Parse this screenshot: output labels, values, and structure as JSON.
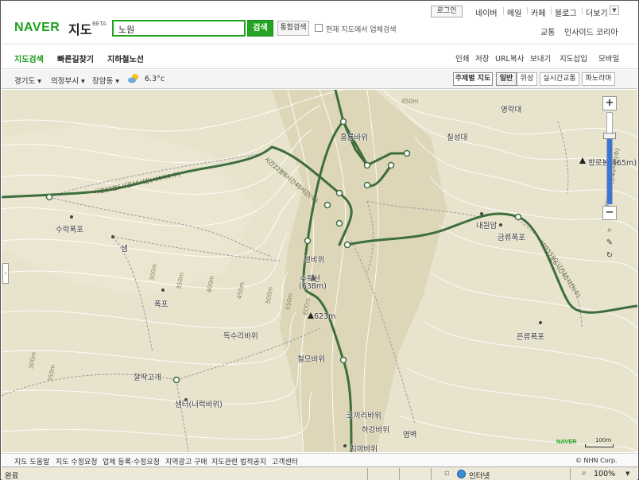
{
  "header": {
    "logo": "NAVER",
    "service": "지도",
    "beta": "BETA",
    "search_value": "노원",
    "search_button": "검색",
    "total_search_button": "통합검색",
    "inmap_label": "현재 지도에서 업체검색",
    "login": "로그인",
    "top_links": [
      "네이버",
      "메일",
      "카페",
      "블로그",
      "더보기"
    ],
    "more_icon": "chevron-down-icon",
    "right_links": [
      "교통",
      "인사이드 코리아"
    ]
  },
  "nav": {
    "tabs": [
      "지도검색",
      "빠른길찾기",
      "지하철노선"
    ],
    "tools": [
      "인쇄",
      "저장",
      "URL복사",
      "보내기",
      "지도삽입",
      "모바일"
    ],
    "active_color": "#1a9a1a"
  },
  "toolbar": {
    "locations": [
      "경기도",
      "의정부시",
      "장암동"
    ],
    "weather_icon": "sun-cloud-icon",
    "temperature": "6.3°c",
    "buttons": [
      "주제별 지도",
      "일반",
      "위성",
      "실시간교통",
      "파노라마"
    ]
  },
  "map": {
    "places": [
      "영락대",
      "흥룡바위",
      "칠성대",
      "향로봉(465m)",
      "내원암",
      "금류폭포",
      "수락폭포",
      "샘",
      "챙비위",
      "수락산",
      "(638m)",
      "폭포",
      "623m",
      "독수리바위",
      "철모바위",
      "은류폭포",
      "깔딱고개",
      "샘터(너럭바위)",
      "코끼리바위",
      "하강바위",
      "염벽",
      "치마바위"
    ],
    "elevations": [
      "450m",
      "300m",
      "350m",
      "400m",
      "450m",
      "500m",
      "550m",
      "600m",
      "300m",
      "350m"
    ],
    "trail_texts": [
      "시간22분6시간40시간(시4시4:수)",
      "시간22분6시간40시간(수)",
      "시간22분6시간40시간(수)",
      "시간22분6시간40시간(수)"
    ],
    "zoom_plus": "+",
    "zoom_minus": "−",
    "zoom_level_fraction": 0.72,
    "tool_icons": [
      "magnifier-icon",
      "ruler-icon",
      "refresh-icon"
    ],
    "watermark": "NAVER",
    "scale": "100m",
    "collapse_icon": "chevron-left-icon",
    "colors": {
      "land": "#e8e3cd",
      "trail": "#3d6e3d",
      "contour": "#ffffff"
    }
  },
  "footer": {
    "links": [
      "지도 도움말",
      "지도 수정요청",
      "업체 등록·수정요청",
      "지역광고 구매",
      "지도관련 법적공지",
      "고객센터"
    ],
    "copyright": "© NHN Corp."
  },
  "statusbar": {
    "status": "완료",
    "zone": "인터넷",
    "zoom": "100%",
    "zone_icon": "globe-icon",
    "zoom_icon": "magnifier-icon"
  }
}
